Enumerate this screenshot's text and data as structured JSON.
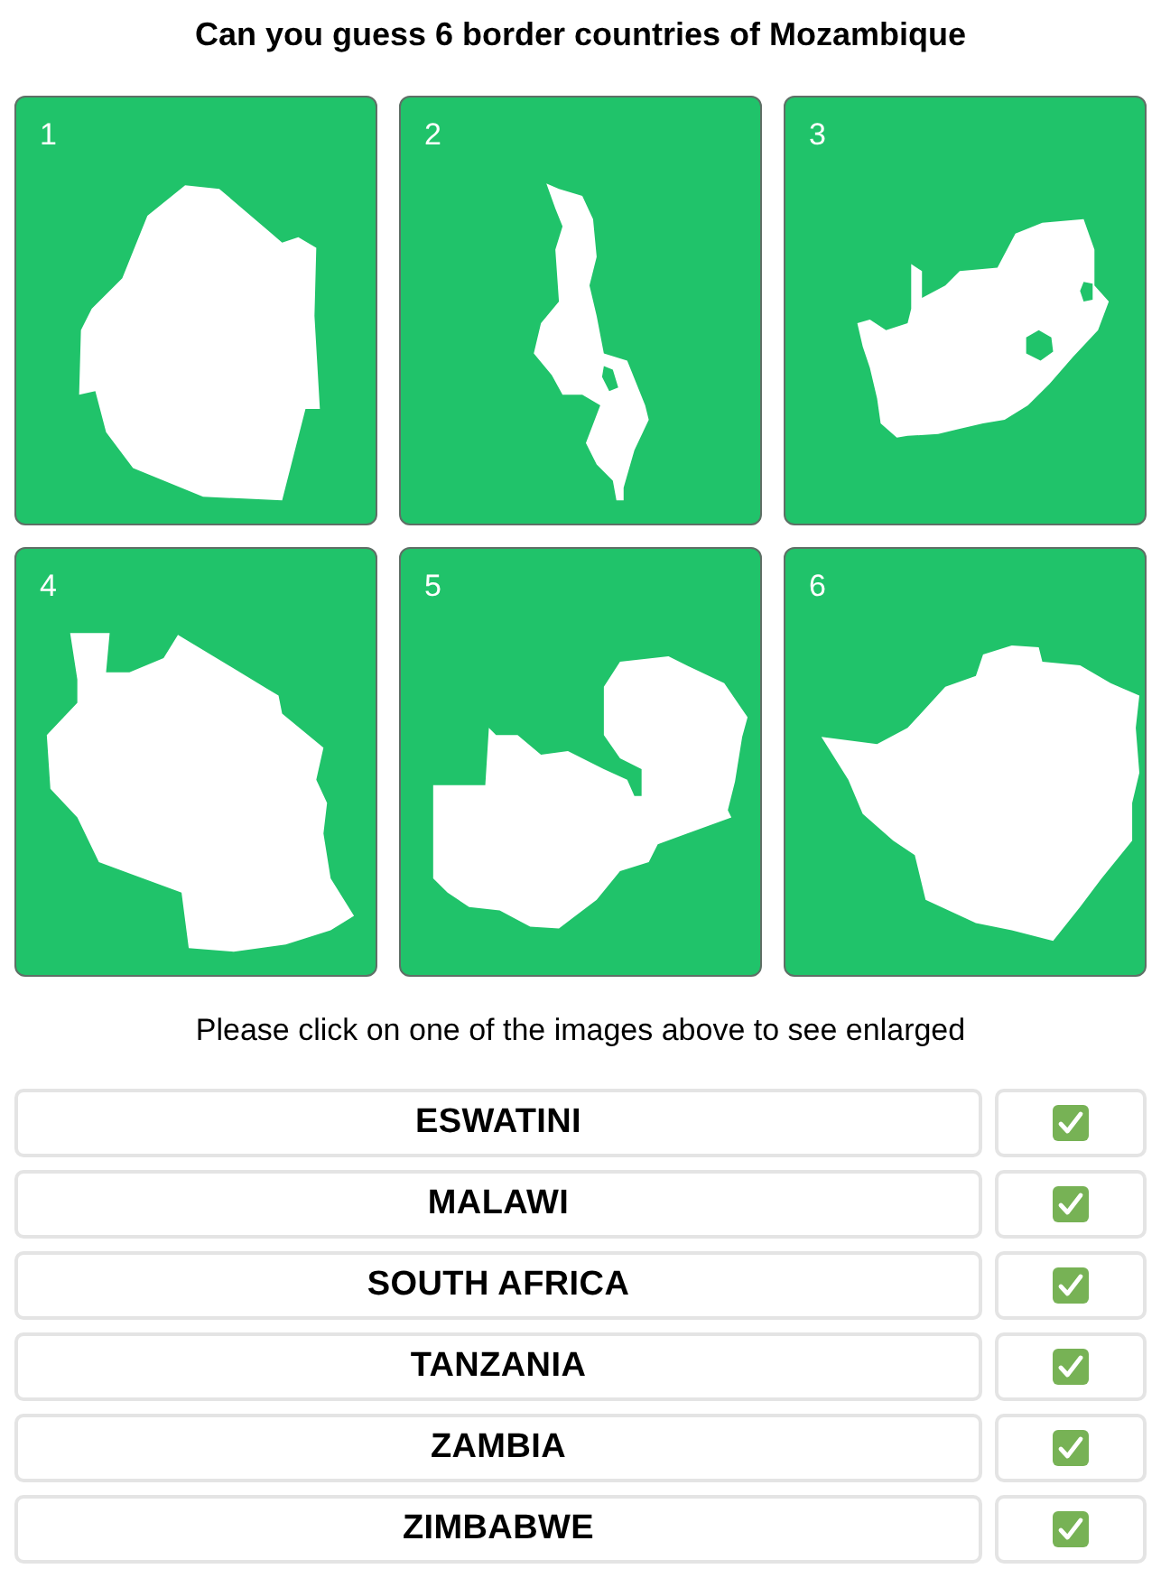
{
  "title": "Can you guess 6 border countries of Mozambique",
  "cards": [
    {
      "number": "1"
    },
    {
      "number": "2"
    },
    {
      "number": "3"
    },
    {
      "number": "4"
    },
    {
      "number": "5"
    },
    {
      "number": "6"
    }
  ],
  "instruction": "Please click on one of the images above to see enlarged",
  "answers": [
    {
      "name": "ESWATINI",
      "checked": true
    },
    {
      "name": "MALAWI",
      "checked": true
    },
    {
      "name": "SOUTH AFRICA",
      "checked": true
    },
    {
      "name": "TANZANIA",
      "checked": true
    },
    {
      "name": "ZAMBIA",
      "checked": true
    },
    {
      "name": "ZIMBABWE",
      "checked": true
    }
  ]
}
